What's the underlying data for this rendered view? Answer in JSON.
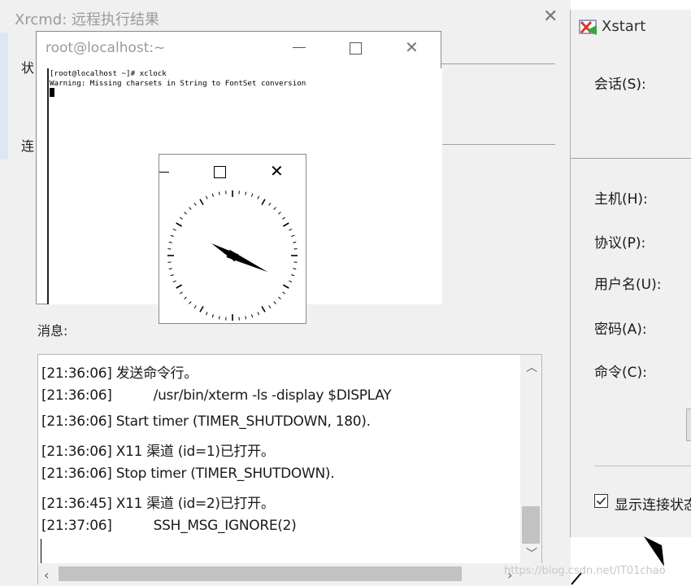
{
  "xrcmd": {
    "title": "Xrcmd: 远程执行结果",
    "status_label": "状",
    "connect_label": "连",
    "messages_label": "消息:",
    "log": [
      "[21:36:06] 发送命令行。",
      "[21:36:06]          /usr/bin/xterm -ls -display $DISPLAY",
      "[21:36:06] Start timer (TIMER_SHUTDOWN, 180).",
      "[21:36:06] X11 渠道 (id=1)已打开。",
      "[21:36:06] Stop timer (TIMER_SHUTDOWN).",
      "[21:36:45] X11 渠道 (id=2)已打开。",
      "[21:37:06]          SSH_MSG_IGNORE(2)"
    ]
  },
  "xterm": {
    "title": "root@localhost:~",
    "lines": [
      "[root@localhost ~]# xclock",
      "Warning: Missing charsets in String to FontSet conversion"
    ]
  },
  "xclock": {
    "time_shown": "3:50"
  },
  "xstart": {
    "title": "Xstart",
    "fields": {
      "session": "会话(S):",
      "host": "主机(H):",
      "protocol": "协议(P):",
      "username": "用户名(U):",
      "password": "密码(A):",
      "command": "命令(C):"
    },
    "checkbox_label": "显示连接状态",
    "checkbox_checked": true
  },
  "watermark": "https://blog.csdn.net/IT01chao"
}
